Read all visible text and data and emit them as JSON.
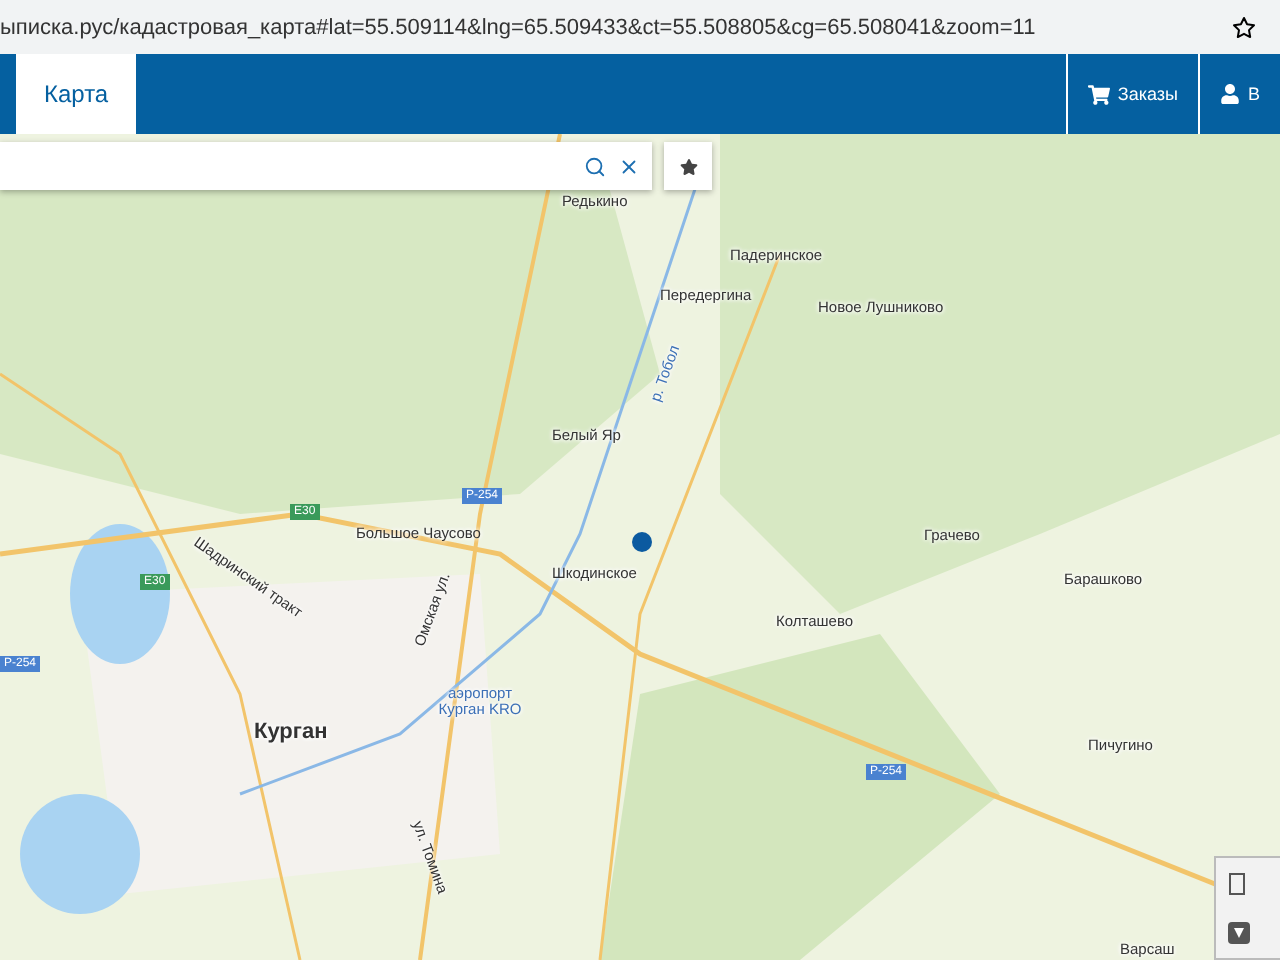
{
  "address_bar": {
    "url": "ыписка.рус/кадастровая_карта#lat=55.509114&lng=65.509433&ct=55.508805&cg=65.508041&zoom=11"
  },
  "nav": {
    "tabs": [
      {
        "label": "Карта",
        "selected": true
      }
    ],
    "actions": [
      {
        "kind": "cart",
        "label": "Заказы"
      },
      {
        "kind": "user",
        "label": "В"
      }
    ]
  },
  "map": {
    "labels": [
      {
        "kind": "place",
        "text": "Редькино"
      },
      {
        "kind": "place",
        "text": "Падеринское"
      },
      {
        "kind": "place",
        "text": "Передергина"
      },
      {
        "kind": "place",
        "text": "Новое Лушниково"
      },
      {
        "kind": "river",
        "text": "р. Тобол"
      },
      {
        "kind": "place",
        "text": "Белый Яр"
      },
      {
        "kind": "place",
        "text": "Большое Чаусово"
      },
      {
        "kind": "place",
        "text": "Грачево"
      },
      {
        "kind": "place",
        "text": "Шкодинское"
      },
      {
        "kind": "place",
        "text": "Барашково"
      },
      {
        "kind": "place",
        "text": "Колташево"
      },
      {
        "kind": "street",
        "text": "Шадринский тракт"
      },
      {
        "kind": "street",
        "text": "Омская ул."
      },
      {
        "kind": "airport",
        "text": "аэропорт Курган KRO"
      },
      {
        "kind": "city",
        "text": "Курган"
      },
      {
        "kind": "place",
        "text": "Пичугино"
      },
      {
        "kind": "street",
        "text": "ул. Томина"
      },
      {
        "kind": "shield",
        "text": "Р-254"
      },
      {
        "kind": "shield",
        "text": "Р-254"
      },
      {
        "kind": "shield",
        "text": "Р-254"
      },
      {
        "kind": "shield",
        "text": "E30"
      },
      {
        "kind": "shield",
        "text": "E30"
      },
      {
        "kind": "place",
        "text": "Варсаш"
      }
    ]
  }
}
